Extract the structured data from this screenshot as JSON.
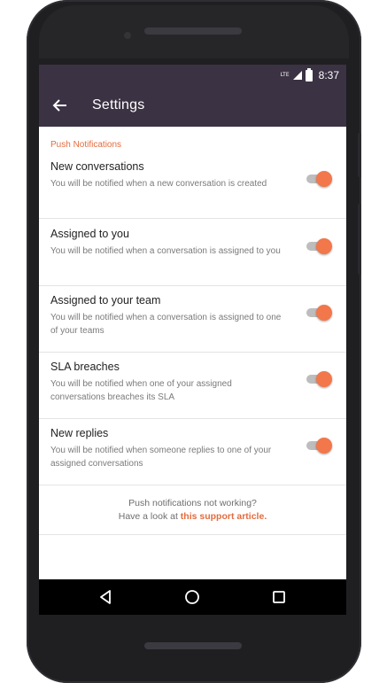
{
  "status_bar": {
    "network_label": "LTE",
    "time": "8:37"
  },
  "app_bar": {
    "title": "Settings",
    "back_icon": "arrow-left-icon"
  },
  "section": {
    "header": "Push Notifications"
  },
  "settings": [
    {
      "title": "New conversations",
      "description": "You will be notified when a new conversation is created",
      "enabled": true
    },
    {
      "title": "Assigned to you",
      "description": "You will be notified when a conversation is assigned to you",
      "enabled": true
    },
    {
      "title": "Assigned to your team",
      "description": "You will be notified when a conversation is assigned to one of your teams",
      "enabled": true
    },
    {
      "title": "SLA breaches",
      "description": "You will be notified when one of your assigned conversations breaches its SLA",
      "enabled": true
    },
    {
      "title": "New replies",
      "description": "You will be notified when someone replies to one of your assigned conversations",
      "enabled": true
    }
  ],
  "footer": {
    "line1": "Push notifications not working?",
    "line2_prefix": "Have a look at ",
    "link_text": "this support article",
    "line2_suffix": "."
  },
  "nav_bar": {
    "back_icon": "triangle-back-icon",
    "home_icon": "circle-home-icon",
    "recents_icon": "square-recents-icon"
  },
  "colors": {
    "app_bar": "#3b3243",
    "accent": "#e36c3e",
    "toggle_thumb": "#f2774b"
  }
}
